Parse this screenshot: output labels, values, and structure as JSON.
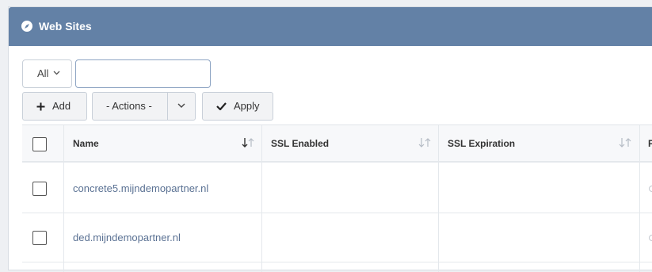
{
  "panel": {
    "title": "Web Sites"
  },
  "filter": {
    "scope_value": "All",
    "search_value": "",
    "search_placeholder": ""
  },
  "toolbar": {
    "add_label": "Add",
    "actions_label": "- Actions -",
    "apply_label": "Apply"
  },
  "table": {
    "columns": [
      {
        "label": "Name",
        "sort_active": true
      },
      {
        "label": "SSL Enabled",
        "sort_active": false
      },
      {
        "label": "SSL Expiration",
        "sort_active": false
      },
      {
        "label": "P",
        "sort_active": false
      }
    ],
    "rows": [
      {
        "name": "concrete5.mijndemopartner.nl",
        "ssl_enabled": "",
        "ssl_expiration": ""
      },
      {
        "name": "ded.mijndemopartner.nl",
        "ssl_enabled": "",
        "ssl_expiration": ""
      }
    ]
  },
  "colors": {
    "header_bg": "#6381a6",
    "link": "#5a7193",
    "sort_active": "#333333",
    "sort_inactive": "#b5bcc5"
  }
}
